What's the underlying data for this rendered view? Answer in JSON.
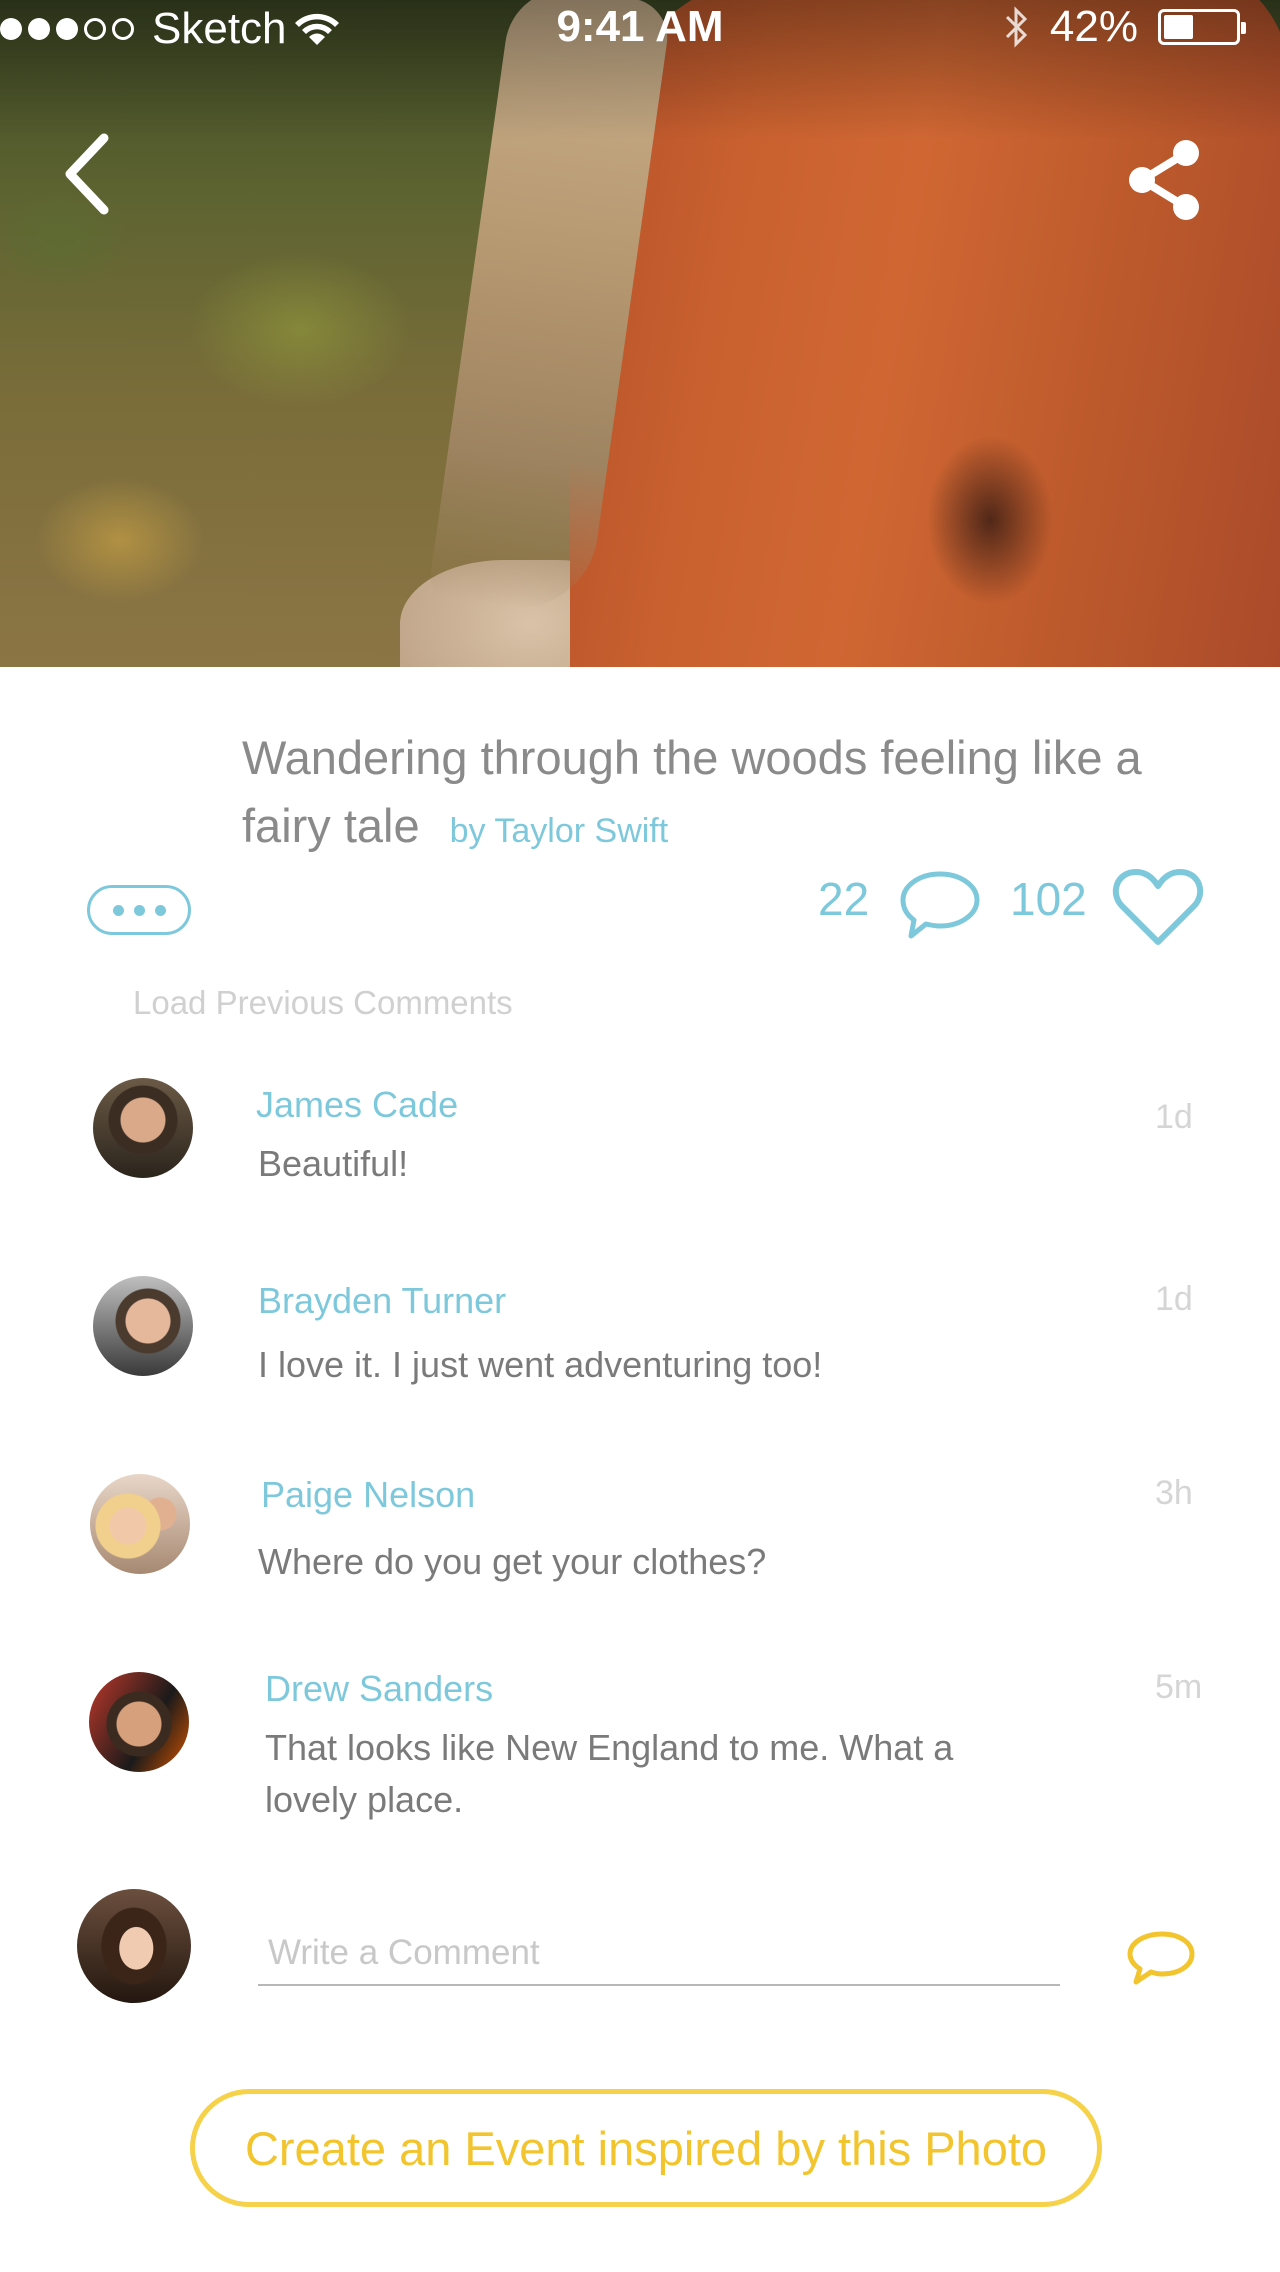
{
  "status_bar": {
    "carrier": "Sketch",
    "time": "9:41 AM",
    "battery": "42%",
    "battery_level": 0.42,
    "signal_strength": 3,
    "signal_max": 5
  },
  "nav": {
    "back_icon": "chevron-left-icon",
    "share_icon": "share-icon"
  },
  "post": {
    "title": "Wandering through the woods feeling like a fairy tale",
    "byline": "by Taylor Swift",
    "comment_count": "22",
    "like_count": "102"
  },
  "load_previous": "Load Previous Comments",
  "comments": [
    {
      "name": "James Cade",
      "text": "Beautiful!",
      "time": "1d"
    },
    {
      "name": "Brayden Turner",
      "text": "I love it. I just went adventuring too!",
      "time": "1d"
    },
    {
      "name": "Paige Nelson",
      "text": "Where do you get your clothes?",
      "time": "3h"
    },
    {
      "name": "Drew Sanders",
      "text": "That looks like New England  to me. What a lovely place.",
      "time": "5m"
    }
  ],
  "composer": {
    "placeholder": "Write a Comment"
  },
  "cta_label": "Create an Event inspired by this Photo",
  "colors": {
    "accent_blue": "#7ec8dc",
    "accent_yellow": "#f2c42d",
    "text_gray": "#8a8a8a"
  }
}
